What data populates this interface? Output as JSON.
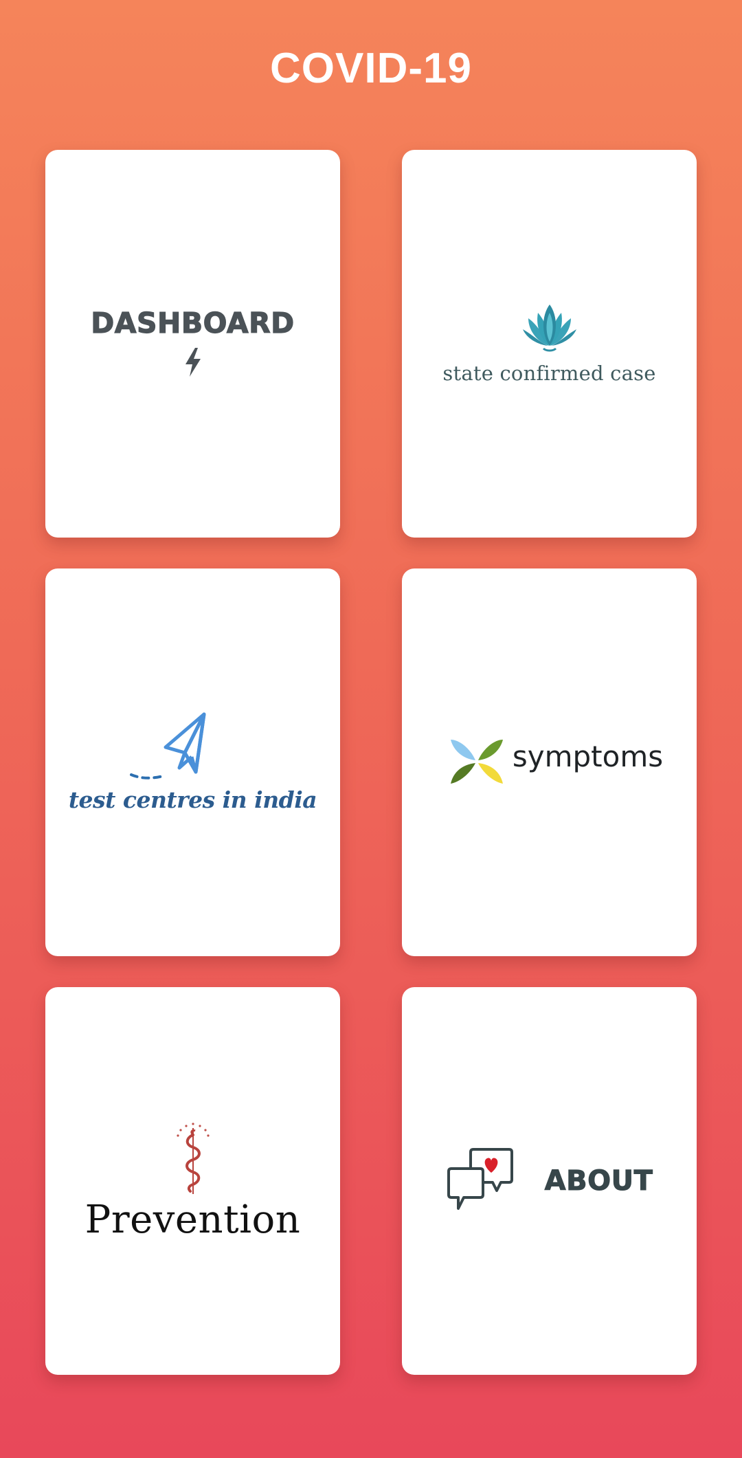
{
  "header": {
    "title": "COVID-19"
  },
  "cards": [
    {
      "label": "DASHBOARD",
      "icon": "lightning-bolt-icon"
    },
    {
      "label": "state confirmed case",
      "icon": "lotus-icon"
    },
    {
      "label": "test centres in india",
      "icon": "paper-plane-icon"
    },
    {
      "label": "symptoms",
      "icon": "four-leaves-icon"
    },
    {
      "label": "Prevention",
      "icon": "caduceus-snake-icon"
    },
    {
      "label": "ABOUT",
      "icon": "chat-bubbles-heart-icon"
    }
  ],
  "colors": {
    "gradient_top": "#f5845a",
    "gradient_bottom": "#e8485a",
    "card_bg": "#ffffff",
    "title": "#ffffff"
  }
}
